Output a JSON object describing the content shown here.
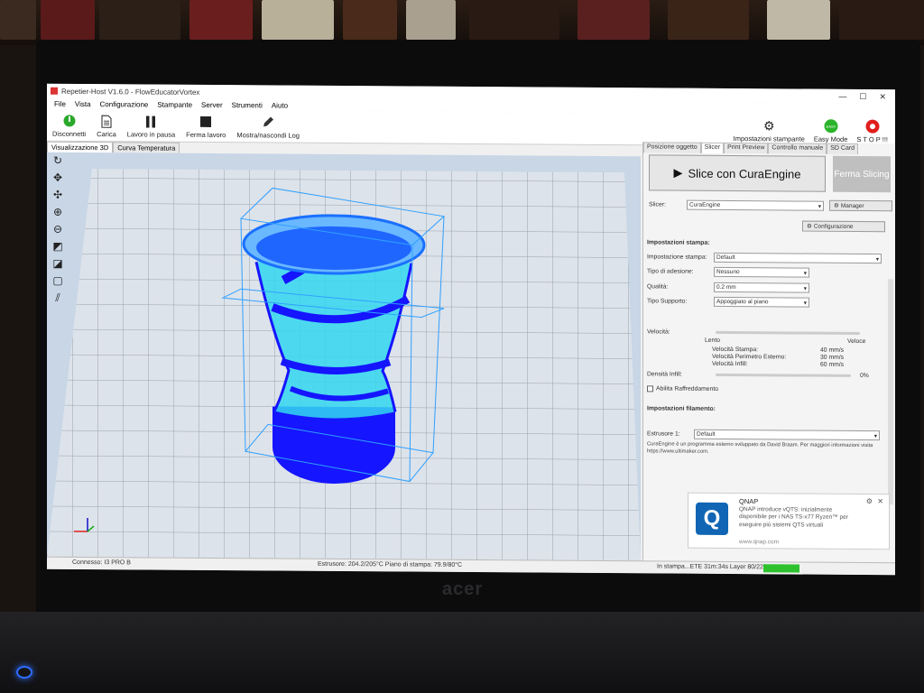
{
  "window": {
    "title": "Repetier-Host V1.6.0 - FlowEducatorVortex",
    "min": "—",
    "max": "☐",
    "close": "✕"
  },
  "menu": [
    "File",
    "Vista",
    "Configurazione",
    "Stampante",
    "Server",
    "Strumenti",
    "Aiuto"
  ],
  "toolbar": {
    "disconnect": "Disconnetti",
    "load": "Carica",
    "pause": "Lavoro in pausa",
    "stop": "Ferma lavoro",
    "toggle_log": "Mostra/nascondi Log",
    "printer_settings": "Impostazioni stampante",
    "easy_mode": "Easy Mode",
    "easy_badge": "EASY",
    "emergency_stop": "S T O P !!!"
  },
  "view_tabs": [
    "Visualizzazione 3D",
    "Curva Temperatura"
  ],
  "right_tabs": [
    "Posizione oggetto",
    "Slicer",
    "Print Preview",
    "Controllo manuale",
    "SD Card"
  ],
  "slicer": {
    "slice_button": "Slice con CuraEngine",
    "stop_slicing": "Ferma Slicing",
    "slicer_label": "Slicer:",
    "slicer_value": "CuraEngine",
    "manager_button": "Manager",
    "config_button": "Configurazione",
    "print_settings_heading": "Impostazioni stampa:",
    "print_setting_label": "Impostazione stampa:",
    "print_setting_value": "Default",
    "adhesion_label": "Tipo di adesione:",
    "adhesion_value": "Nessuno",
    "quality_label": "Qualità:",
    "quality_value": "0.2 mm",
    "support_label": "Tipo Supporto:",
    "support_value": "Appoggiato al piano",
    "speed_label": "Velocità:",
    "speed_slow": "Lento",
    "speed_fast": "Veloce",
    "speed_print_label": "Velocità Stampa:",
    "speed_print_value": "40 mm/s",
    "speed_outer_label": "Velocità Perimetro Esterno:",
    "speed_outer_value": "30 mm/s",
    "speed_infill_label": "Velocità Infill:",
    "speed_infill_value": "60 mm/s",
    "infill_density_label": "Densità Infill:",
    "infill_density_value": "0%",
    "cooling_label": "Abilita Raffreddamento",
    "filament_heading": "Impostazioni filamento:",
    "extruder_label": "Estrusore 1:",
    "extruder_value": "Default",
    "footer_note": "CuraEngine è un programma esterno sviluppato da David Braam. Per maggiori informazioni visita https://www.ultimaker.com."
  },
  "notification": {
    "title": "QNAP",
    "body": "QNAP introduce vQTS: inizialmente disponibile per i NAS TS-x77 Ryzen™ per eseguire più sistemi QTS virtuali",
    "url": "www.qnap.com"
  },
  "status": {
    "connection": "Connesso: I3 PRO B",
    "temps": "Estrusore: 204.2/205°C Piano di stampa: 79.9/80°C",
    "job": "In stampa...ETE 31m:34s Layer 80/222"
  },
  "brand": "acer",
  "colors": {
    "model": "#1515ff",
    "mesh": "#33e0ff",
    "bbox": "#30a0ff",
    "progress": "#2dc22d"
  }
}
